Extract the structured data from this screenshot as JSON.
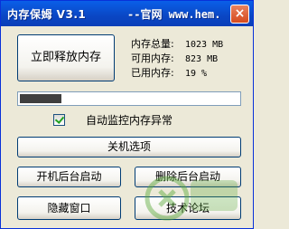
{
  "window": {
    "title": "内存保姆 V3.1",
    "title_site": "--官网 www.hem...",
    "close_glyph": "×"
  },
  "buttons": {
    "release": "立即释放内存",
    "shutdown": "关机选项",
    "startup": "开机后台启动",
    "delete_startup": "删除后台启动",
    "hide": "隐藏窗口",
    "forum": "技术论坛"
  },
  "memory": {
    "total_label": "内存总量:",
    "total_value": "1023 MB",
    "available_label": "可用内存:",
    "available_value": "823 MB",
    "used_label": "已用内存:",
    "used_value": "19 %",
    "used_fraction": 0.19
  },
  "monitor": {
    "label": "自动监控内存异常",
    "checked": true
  },
  "colors": {
    "titlebar": "#0a4fd0",
    "progress_fill": "#3f3f3f",
    "window_bg": "#ece9d8"
  }
}
